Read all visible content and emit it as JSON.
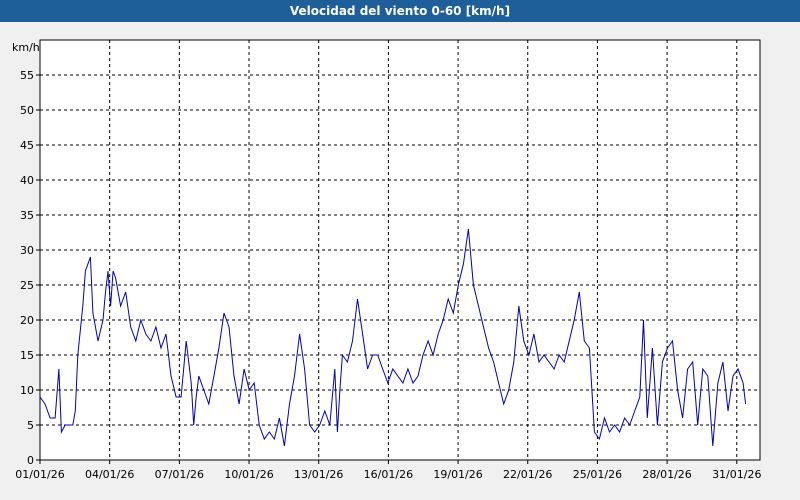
{
  "window": {
    "title": "Velocidad del viento 0-60 [km/h]"
  },
  "chart_data": {
    "type": "line",
    "title": "Velocidad del viento 0-60 [km/h]",
    "ylabel": "km/h",
    "xlabel": "",
    "ylim": [
      0,
      60
    ],
    "xlim_days": [
      0,
      31
    ],
    "y_ticks": [
      0,
      5,
      10,
      15,
      20,
      25,
      30,
      35,
      40,
      45,
      50,
      55
    ],
    "x_tick_labels": [
      "01/01/26",
      "04/01/26",
      "07/01/26",
      "10/01/26",
      "13/01/26",
      "16/01/26",
      "19/01/26",
      "22/01/26",
      "25/01/26",
      "28/01/26",
      "31/01/26"
    ],
    "grid": true,
    "line_color": "#0000b4",
    "series": [
      {
        "values": [
          [
            0.0,
            9
          ],
          [
            0.2,
            8
          ],
          [
            0.4,
            6
          ],
          [
            0.6,
            6
          ],
          [
            0.75,
            13
          ],
          [
            0.85,
            4
          ],
          [
            1.0,
            5
          ],
          [
            1.3,
            5
          ],
          [
            1.4,
            7
          ],
          [
            1.5,
            15
          ],
          [
            1.7,
            22
          ],
          [
            1.8,
            27
          ],
          [
            2.0,
            29
          ],
          [
            2.1,
            21
          ],
          [
            2.3,
            17
          ],
          [
            2.5,
            20
          ],
          [
            2.6,
            24
          ],
          [
            2.7,
            27
          ],
          [
            2.8,
            22
          ],
          [
            2.9,
            27
          ],
          [
            3.0,
            26
          ],
          [
            3.1,
            24
          ],
          [
            3.2,
            22
          ],
          [
            3.4,
            24
          ],
          [
            3.6,
            19
          ],
          [
            3.8,
            17
          ],
          [
            4.0,
            20
          ],
          [
            4.2,
            18
          ],
          [
            4.4,
            17
          ],
          [
            4.6,
            19
          ],
          [
            4.8,
            16
          ],
          [
            5.0,
            18
          ],
          [
            5.2,
            12
          ],
          [
            5.4,
            9
          ],
          [
            5.6,
            9
          ],
          [
            5.8,
            17
          ],
          [
            5.9,
            14
          ],
          [
            6.0,
            11
          ],
          [
            6.1,
            5
          ],
          [
            6.2,
            9
          ],
          [
            6.3,
            12
          ],
          [
            6.5,
            10
          ],
          [
            6.7,
            8
          ],
          [
            6.9,
            12
          ],
          [
            7.1,
            16
          ],
          [
            7.3,
            21
          ],
          [
            7.5,
            19
          ],
          [
            7.7,
            12
          ],
          [
            7.9,
            8
          ],
          [
            8.1,
            13
          ],
          [
            8.3,
            10
          ],
          [
            8.5,
            11
          ],
          [
            8.7,
            5
          ],
          [
            8.9,
            3
          ],
          [
            9.1,
            4
          ],
          [
            9.3,
            3
          ],
          [
            9.5,
            6
          ],
          [
            9.7,
            2
          ],
          [
            9.9,
            8
          ],
          [
            10.1,
            12
          ],
          [
            10.3,
            18
          ],
          [
            10.5,
            13
          ],
          [
            10.7,
            5
          ],
          [
            10.9,
            4
          ],
          [
            11.1,
            5
          ],
          [
            11.3,
            7
          ],
          [
            11.5,
            5
          ],
          [
            11.7,
            13
          ],
          [
            11.8,
            4
          ],
          [
            11.9,
            10
          ],
          [
            12.0,
            15
          ],
          [
            12.2,
            14
          ],
          [
            12.4,
            17
          ],
          [
            12.6,
            23
          ],
          [
            12.8,
            18
          ],
          [
            13.0,
            13
          ],
          [
            13.2,
            15
          ],
          [
            13.4,
            15
          ],
          [
            13.6,
            13
          ],
          [
            13.8,
            11
          ],
          [
            14.0,
            13
          ],
          [
            14.2,
            12
          ],
          [
            14.4,
            11
          ],
          [
            14.6,
            13
          ],
          [
            14.8,
            11
          ],
          [
            15.0,
            12
          ],
          [
            15.2,
            15
          ],
          [
            15.4,
            17
          ],
          [
            15.6,
            15
          ],
          [
            15.8,
            18
          ],
          [
            16.0,
            20
          ],
          [
            16.2,
            23
          ],
          [
            16.4,
            21
          ],
          [
            16.6,
            25
          ],
          [
            16.8,
            28
          ],
          [
            17.0,
            33
          ],
          [
            17.2,
            25
          ],
          [
            17.4,
            22
          ],
          [
            17.6,
            19
          ],
          [
            17.8,
            16
          ],
          [
            18.0,
            14
          ],
          [
            18.2,
            11
          ],
          [
            18.4,
            8
          ],
          [
            18.6,
            10
          ],
          [
            18.8,
            14
          ],
          [
            19.0,
            22
          ],
          [
            19.2,
            17
          ],
          [
            19.4,
            15
          ],
          [
            19.6,
            18
          ],
          [
            19.8,
            14
          ],
          [
            20.0,
            15
          ],
          [
            20.2,
            14
          ],
          [
            20.4,
            13
          ],
          [
            20.6,
            15
          ],
          [
            20.8,
            14
          ],
          [
            21.0,
            17
          ],
          [
            21.2,
            20
          ],
          [
            21.4,
            24
          ],
          [
            21.6,
            17
          ],
          [
            21.8,
            16
          ],
          [
            22.0,
            4
          ],
          [
            22.2,
            3
          ],
          [
            22.4,
            6
          ],
          [
            22.6,
            4
          ],
          [
            22.8,
            5
          ],
          [
            23.0,
            4
          ],
          [
            23.2,
            6
          ],
          [
            23.4,
            5
          ],
          [
            23.6,
            7
          ],
          [
            23.8,
            9
          ],
          [
            23.95,
            20
          ],
          [
            24.1,
            6
          ],
          [
            24.3,
            16
          ],
          [
            24.5,
            5
          ],
          [
            24.7,
            14
          ],
          [
            24.9,
            16
          ],
          [
            25.1,
            17
          ],
          [
            25.3,
            10
          ],
          [
            25.5,
            6
          ],
          [
            25.7,
            13
          ],
          [
            25.9,
            14
          ],
          [
            26.1,
            5
          ],
          [
            26.3,
            13
          ],
          [
            26.5,
            12
          ],
          [
            26.7,
            2
          ],
          [
            26.9,
            11
          ],
          [
            27.1,
            14
          ],
          [
            27.3,
            7
          ],
          [
            27.5,
            12
          ],
          [
            27.7,
            13
          ],
          [
            27.9,
            11
          ],
          [
            28.0,
            8
          ]
        ]
      }
    ]
  }
}
